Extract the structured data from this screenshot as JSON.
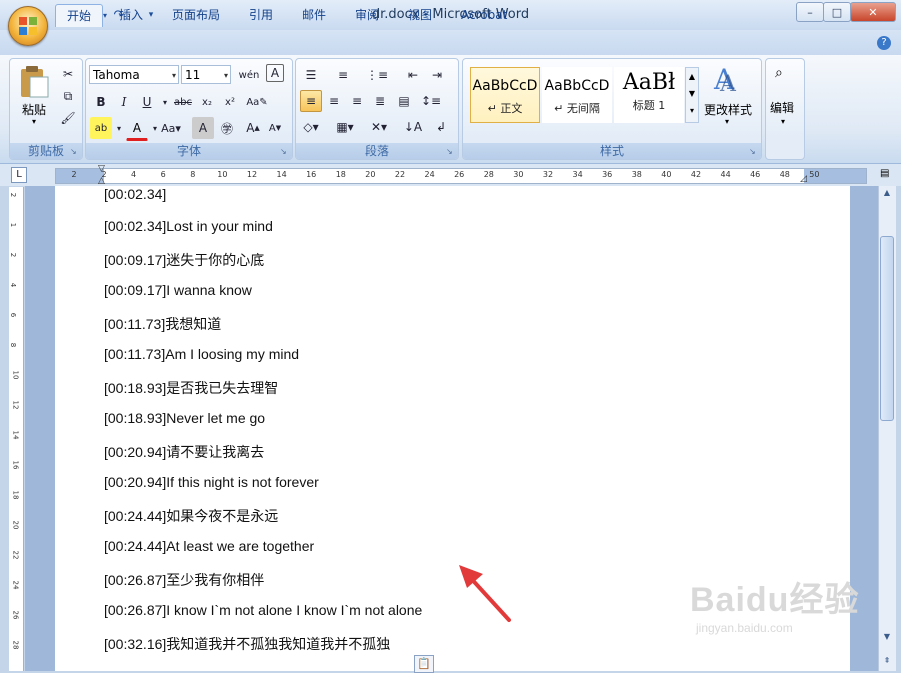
{
  "window": {
    "title": "dr.docx - Microsoft Word",
    "quick_access": [
      "save-icon",
      "undo-icon",
      "redo-icon",
      "customize-icon"
    ]
  },
  "tabs": [
    "开始",
    "插入",
    "页面布局",
    "引用",
    "邮件",
    "审阅",
    "视图",
    "Acrobat"
  ],
  "ribbon": {
    "clipboard": {
      "label": "剪贴板",
      "paste_label": "粘贴"
    },
    "font": {
      "label": "字体",
      "font_name": "Tahoma",
      "font_size": "11"
    },
    "paragraph": {
      "label": "段落"
    },
    "styles": {
      "label": "样式",
      "items": [
        {
          "sample": "AaBbCcD",
          "name": "↵ 正文",
          "selected": true
        },
        {
          "sample": "AaBbCcD",
          "name": "↵ 无间隔",
          "selected": false
        },
        {
          "sample": "AaBł",
          "name": "标题 1",
          "selected": false
        }
      ],
      "change_styles_label": "更改样式"
    },
    "editing": {
      "label": "编辑"
    }
  },
  "ruler": {
    "marks": [
      "2",
      "2",
      "4",
      "6",
      "8",
      "10",
      "12",
      "14",
      "16",
      "18",
      "20",
      "22",
      "24",
      "26",
      "28",
      "30",
      "32",
      "34",
      "36",
      "38",
      "40",
      "42",
      "44",
      "46",
      "48",
      "50"
    ]
  },
  "vertical_ruler": {
    "marks": [
      "2",
      "1",
      "2",
      "4",
      "6",
      "8",
      "10",
      "12",
      "14",
      "16",
      "18",
      "20",
      "22",
      "24",
      "26",
      "28"
    ]
  },
  "document": {
    "lines": [
      "[00:02.34]",
      "[00:02.34]Lost in your mind",
      "[00:09.17]迷失于你的心底",
      "[00:09.17]I wanna know",
      "[00:11.73]我想知道",
      "[00:11.73]Am I loosing my mind",
      "[00:18.93]是否我已失去理智",
      "[00:18.93]Never let me go",
      "[00:20.94]请不要让我离去",
      "[00:20.94]If this night is not forever",
      "[00:24.44]如果今夜不是永远",
      "[00:24.44]At least we are together",
      "[00:26.87]至少我有你相伴",
      "[00:26.87]I know I`m not alone I know I`m not alone",
      "[00:32.16]我知道我并不孤独我知道我并不孤独"
    ]
  },
  "watermark": {
    "text": "Baidu经验",
    "url": "jingyan.baidu.com"
  },
  "colors": {
    "arrow": "#e23a3a",
    "ribbon_bg": "#dfe9f5",
    "tab_text": "#15428b"
  }
}
